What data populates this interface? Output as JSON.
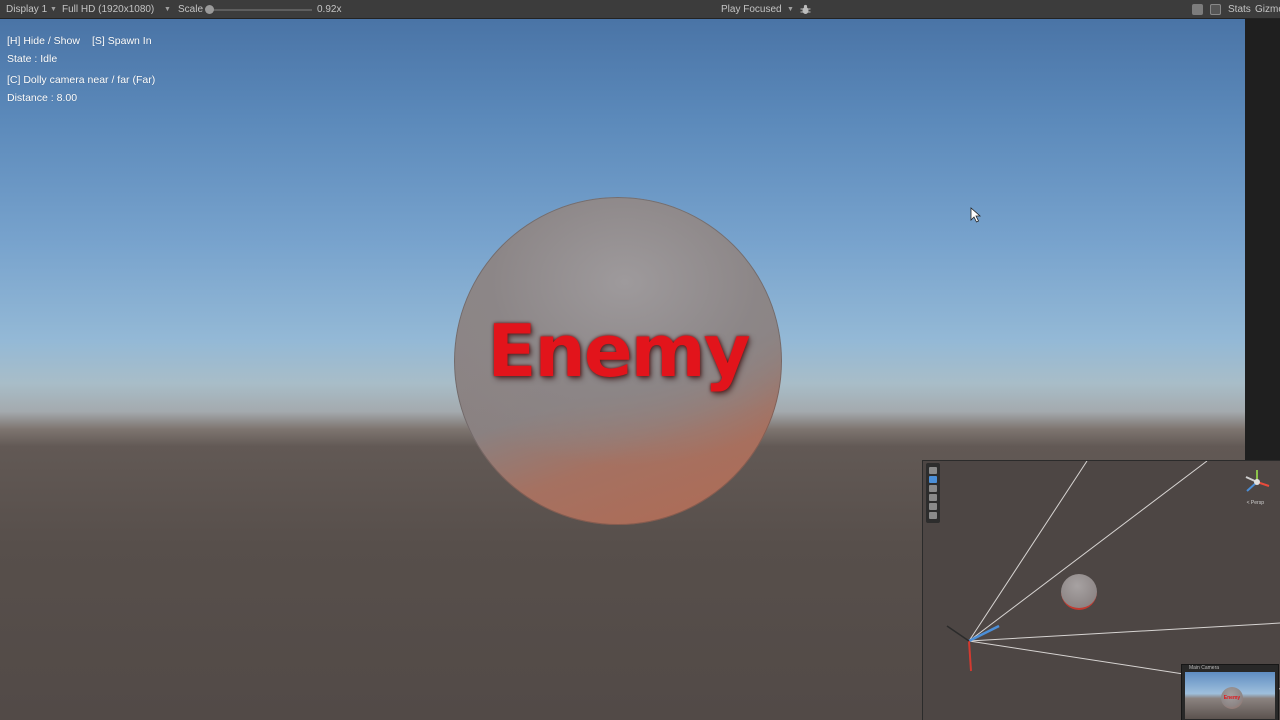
{
  "toolbar": {
    "display": "Display 1",
    "resolution": "Full HD (1920x1080)",
    "scale_label": "Scale",
    "scale_value": "0.92x",
    "play_mode": "Play Focused",
    "stats": "Stats",
    "gizmos": "Gizmo"
  },
  "hud": {
    "controls": "[H] Hide / Show",
    "spawn": "[S] Spawn In",
    "state": "State : Idle",
    "dolly": "[C] Dolly camera near / far  (Far)",
    "distance": "Distance : 8.00"
  },
  "enemy": {
    "label": "Enemy"
  },
  "scene_view": {
    "persp": "< Persp",
    "camera_preview_title": "Main Camera",
    "camera_preview_label": "Enemy"
  },
  "icons": {
    "dropdown": "chevron-down-icon",
    "bug": "bug-icon",
    "mute": "speaker-icon",
    "stats": "stats-icon",
    "cursor": "mouse-cursor-icon",
    "gizmo": "axis-gizmo-icon"
  },
  "colors": {
    "enemy_text": "#e2141b",
    "selected_tool": "#4b8fd8"
  }
}
